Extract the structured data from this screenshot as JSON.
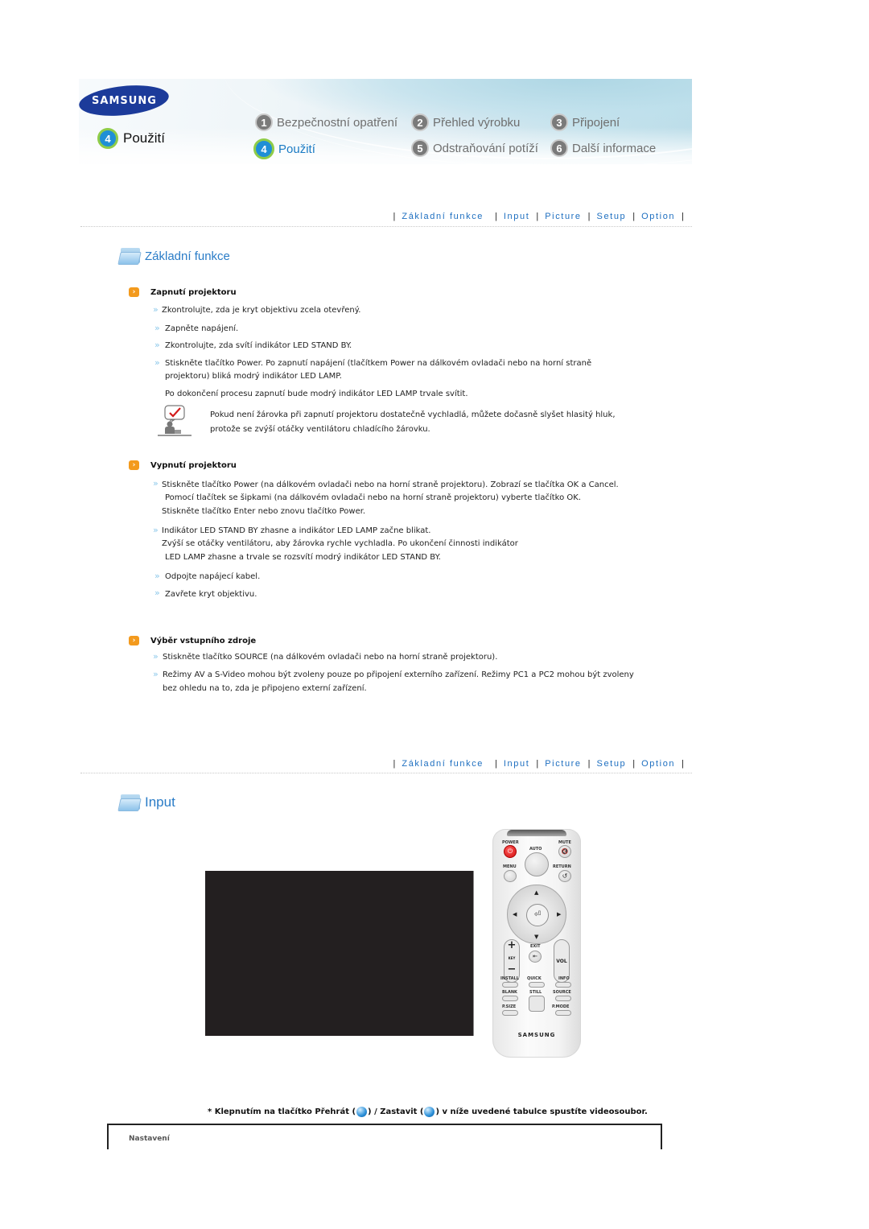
{
  "header": {
    "logo_text": "SAMSUNG",
    "current_section": {
      "number": "4",
      "label": "Použití"
    },
    "nav": [
      {
        "number": "1",
        "label": "Bezpečnostní opatření",
        "active": false
      },
      {
        "number": "2",
        "label": "Přehled výrobku",
        "active": false
      },
      {
        "number": "3",
        "label": "Připojení",
        "active": false
      },
      {
        "number": "4",
        "label": "Použití",
        "active": true
      },
      {
        "number": "5",
        "label": "Odstraňování potíží",
        "active": false
      },
      {
        "number": "6",
        "label": "Další informace",
        "active": false
      }
    ]
  },
  "section_nav": {
    "links": [
      "Základní funkce",
      "Input",
      "Picture",
      "Setup",
      "Option"
    ],
    "separator": "|"
  },
  "basic": {
    "title": "Základní funkce",
    "power_on": {
      "heading": "Zapnutí projektoru",
      "lines": [
        "Zkontrolujte, zda je kryt objektivu zcela otevřený.",
        "Zapněte napájení.",
        "Zkontrolujte, zda svítí indikátor LED STAND BY.",
        "Stiskněte tlačítko Power. Po zapnutí napájení (tlačítkem Power na dálkovém ovladači nebo na horní straně",
        "projektoru) bliká modrý indikátor LED LAMP.",
        "Po dokončení procesu zapnutí bude modrý indikátor LED LAMP trvale svítit."
      ],
      "note": [
        "Pokud není žárovka při zapnutí projektoru dostatečně vychladlá, můžete dočasně slyšet hlasitý hluk,",
        "protože se zvýší otáčky ventilátoru chladícího žárovku."
      ]
    },
    "power_off": {
      "heading": "Vypnutí projektoru",
      "lines": [
        "Stiskněte tlačítko Power (na dálkovém ovladači nebo na horní straně projektoru). Zobrazí se tlačítka OK a Cancel.",
        "Pomocí tlačítek se šipkami (na dálkovém ovladači nebo na horní straně projektoru) vyberte tlačítko OK.",
        "Stiskněte tlačítko Enter nebo znovu tlačítko Power.",
        "Indikátor LED STAND BY zhasne a indikátor LED LAMP začne blikat.",
        "Zvýší se otáčky ventilátoru, aby žárovka rychle vychladla. Po ukončení činnosti indikátor",
        "LED LAMP zhasne a trvale se rozsvítí modrý indikátor LED STAND BY.",
        "Odpojte napájecí kabel.",
        "Zavřete kryt objektivu."
      ]
    },
    "source": {
      "heading": "Výběr vstupního zdroje",
      "lines": [
        "Stiskněte tlačítko SOURCE (na dálkovém ovladači nebo na horní straně projektoru).",
        "Režimy AV a S-Video mohou být zvoleny pouze po připojení externího zařízení. Režimy PC1 a PC2 mohou být zvoleny",
        "bez ohledu na to, zda je připojeno externí zařízení."
      ]
    }
  },
  "input": {
    "title": "Input",
    "remote": {
      "labels": {
        "power": "POWER",
        "auto": "AUTO",
        "mute": "MUTE",
        "menu": "MENU",
        "return": "RETURN",
        "exit": "EXIT",
        "vol": "VOL",
        "install": "INSTALL",
        "quick": "QUICK",
        "info": "INFO",
        "blank": "BLANK",
        "still": "STILL",
        "source": "SOURCE",
        "psize": "P.SIZE",
        "pmode": "P.MODE",
        "brand": "SAMSUNG"
      }
    },
    "footnote": {
      "prefix": "* Klepnutím na tlačítko Přehrát (",
      "middle": ") / Zastavit (",
      "suffix": ") v níže uvedené tabulce spustíte videosoubor."
    },
    "table": {
      "first_cell": "Nastavení"
    }
  }
}
